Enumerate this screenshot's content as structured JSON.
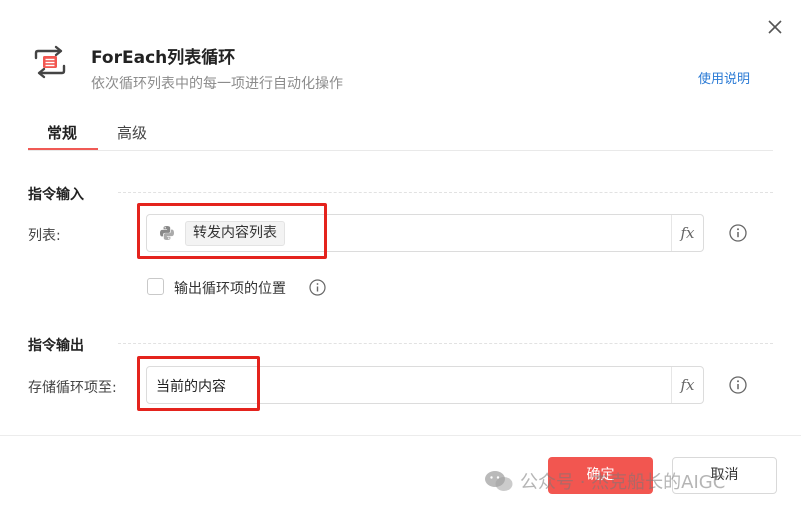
{
  "dialog": {
    "title": "ForEach列表循环",
    "subtitle": "依次循环列表中的每一项进行自动化操作",
    "help_link": "使用说明"
  },
  "tabs": [
    {
      "label": "常规",
      "active": true
    },
    {
      "label": "高级",
      "active": false
    }
  ],
  "input_section": {
    "title": "指令输入",
    "list_field": {
      "label": "列表:",
      "variable_tag": "转发内容列表",
      "variable_icon": "python-icon",
      "fx_label": "fx"
    },
    "checkbox": {
      "label": "输出循环项的位置",
      "checked": false
    }
  },
  "output_section": {
    "title": "指令输出",
    "store_field": {
      "label": "存储循环项至:",
      "value": "当前的内容",
      "fx_label": "fx"
    }
  },
  "footer": {
    "ok_label": "确定",
    "cancel_label": "取消"
  },
  "watermark": {
    "text": "公众号 · 杰克船长的AIGC"
  },
  "colors": {
    "accent_red": "#f25650",
    "highlight_red": "#e4231d",
    "link_blue": "#2a7ad5",
    "tab_underline": "#f05a55"
  }
}
